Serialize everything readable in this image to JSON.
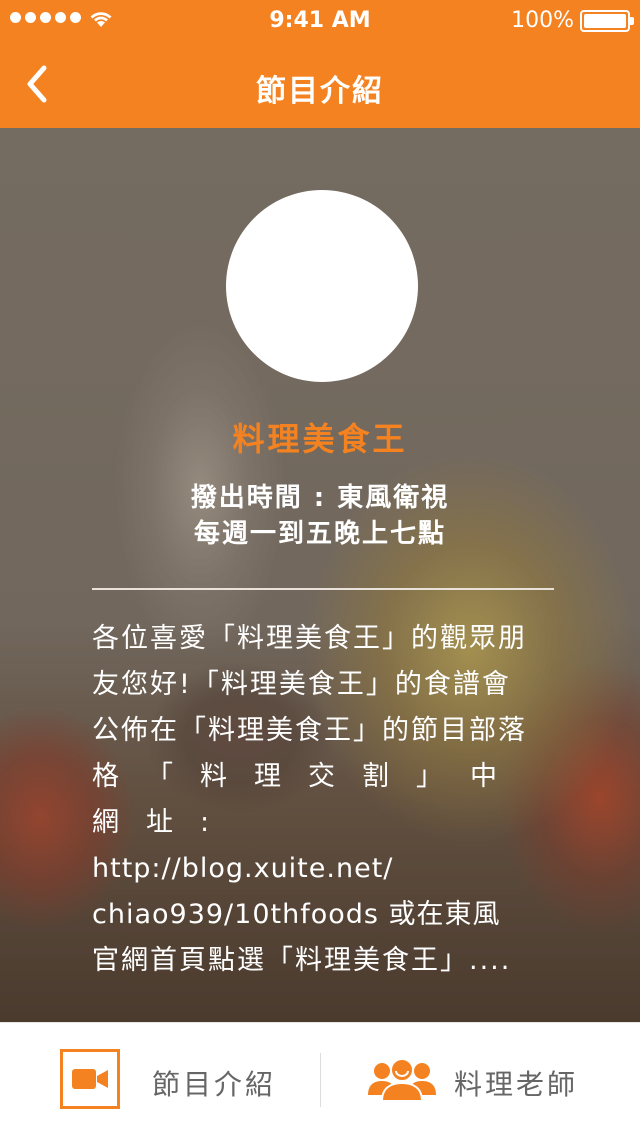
{
  "status_bar": {
    "time": "9:41 AM",
    "battery": "100%",
    "icons": [
      "signal-dots-icon",
      "wifi-icon",
      "battery-icon"
    ]
  },
  "nav": {
    "title": "節目介紹",
    "back_icon": "chevron-left-icon"
  },
  "show": {
    "name": "料理美食王",
    "airtime_line1": "撥出時間 : 東風衛視",
    "airtime_line2": "每週一到五晚上七點",
    "description": [
      "各位喜愛「料理美食王」的觀眾朋",
      "友您好!「料理美食王」的食譜會",
      "公佈在「料理美食王」的節目部落",
      "格「料理交割」中網址:",
      "http://blog.xuite.net/",
      "chiao939/10thfoods 或在東風",
      "官網首頁點選「料理美食王」...."
    ]
  },
  "tabbar": {
    "tabs": [
      {
        "label": "節目介紹",
        "icon": "video-camera-icon",
        "active": true
      },
      {
        "label": "料理老師",
        "icon": "people-icon",
        "active": false
      }
    ]
  },
  "colors": {
    "accent": "#f58220",
    "tab_text": "#666666"
  }
}
